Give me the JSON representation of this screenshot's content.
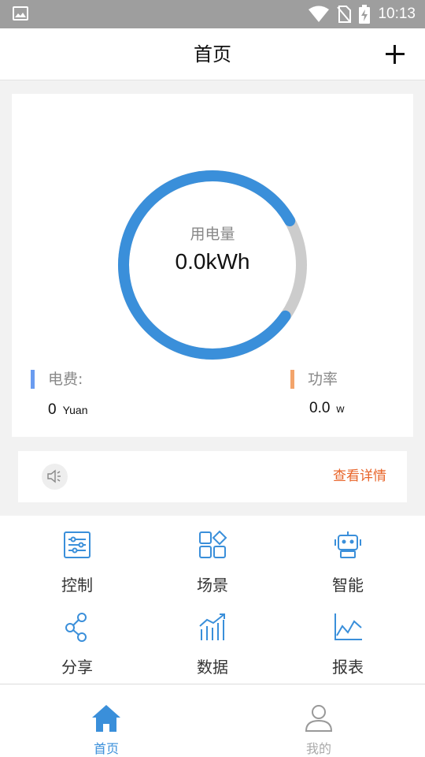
{
  "status_bar": {
    "time": "10:13"
  },
  "app_bar": {
    "title": "首页"
  },
  "usage": {
    "label": "用电量",
    "value": "0.0kWh",
    "ring_fill_fraction": 0.82,
    "ring_color": "#3a8fda",
    "track_color": "#cccccc"
  },
  "stats": {
    "fee": {
      "label": "电费:",
      "value": "0",
      "unit": "Yuan",
      "color": "#6a9cf0"
    },
    "power": {
      "label": "功率",
      "value": "0.0",
      "unit": "w",
      "color": "#f3a46b"
    }
  },
  "notice": {
    "detail_label": "查看详情",
    "icon": "speaker-icon"
  },
  "grid": {
    "items": [
      {
        "label": "控制",
        "icon": "sliders-icon"
      },
      {
        "label": "场景",
        "icon": "scene-icon"
      },
      {
        "label": "智能",
        "icon": "robot-icon"
      },
      {
        "label": "分享",
        "icon": "share-icon"
      },
      {
        "label": "数据",
        "icon": "data-chart-icon"
      },
      {
        "label": "报表",
        "icon": "report-chart-icon"
      }
    ]
  },
  "tabs": [
    {
      "label": "首页",
      "icon": "home-icon",
      "active": true
    },
    {
      "label": "我的",
      "icon": "user-icon",
      "active": false
    }
  ],
  "colors": {
    "accent": "#3a8fda",
    "link": "#e8652a"
  }
}
